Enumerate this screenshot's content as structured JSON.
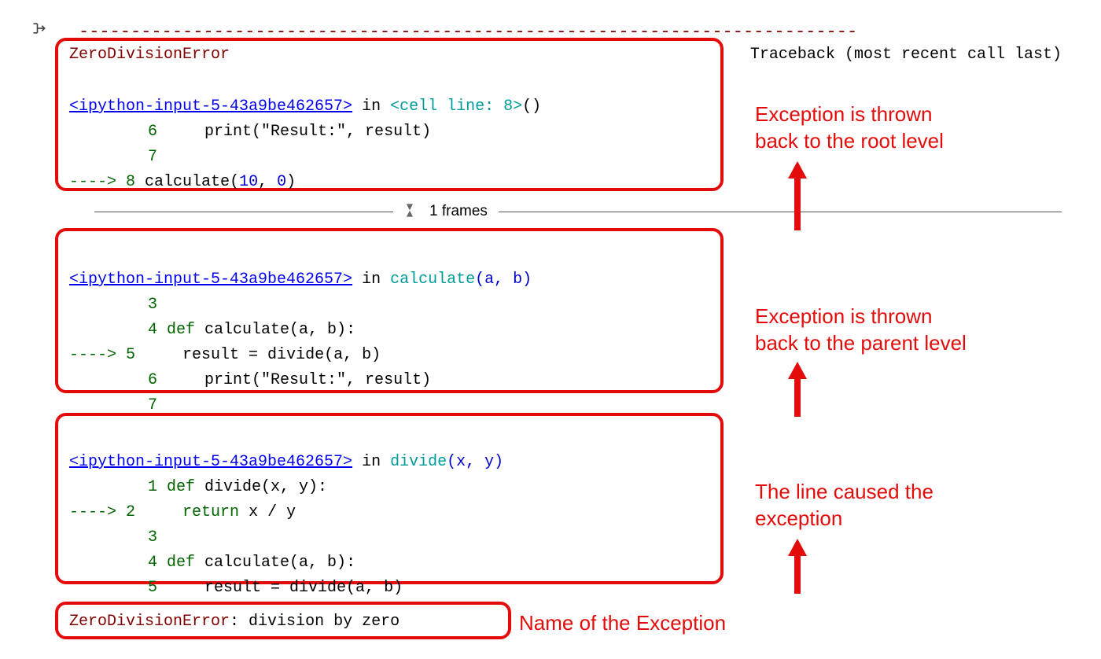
{
  "dash_line": "---------------------------------------------------------------------------",
  "header": {
    "error_name": "ZeroDivisionError",
    "traceback_label": "Traceback (most recent call last)"
  },
  "frame1": {
    "link": "<ipython-input-5-43a9be462657>",
    "in_word": " in ",
    "scope": "<cell line: 8>",
    "paren": "()",
    "l6_num": "6",
    "l6_code": "     print(\"Result:\", result)",
    "l7_num": "7",
    "l7_code": "",
    "arrow": "----> ",
    "l8_num": "8",
    "l8_pre": " calculate",
    "l8_p1": "(",
    "l8_a1": "10",
    "l8_c": ", ",
    "l8_a2": "0",
    "l8_p2": ")"
  },
  "frames_label": "1 frames",
  "frame2": {
    "link": "<ipython-input-5-43a9be462657>",
    "in_word": " in ",
    "scope": "calculate",
    "args": "(a, b)",
    "l3_num": "3",
    "l4_num": "4",
    "l4_kw": " def",
    "l4_rest": " calculate(a, b):",
    "arrow": "----> ",
    "l5_num": "5",
    "l5_code": "     result = divide(a, b)",
    "l6_num": "6",
    "l6_code": "     print(\"Result:\", result)",
    "l7_num": "7"
  },
  "frame3": {
    "link": "<ipython-input-5-43a9be462657>",
    "in_word": " in ",
    "scope": "divide",
    "args": "(x, y)",
    "l1_num": "1",
    "l1_kw": " def",
    "l1_rest": " divide(x, y):",
    "arrow": "----> ",
    "l2_num": "2",
    "l2_kw": "     return",
    "l2_rest": " x / y",
    "l3_num": "3",
    "l4_num": "4",
    "l4_kw": " def",
    "l4_rest": " calculate(a, b):",
    "l5_num": "5",
    "l5_code": "     result = divide(a, b)"
  },
  "summary": {
    "name": "ZeroDivisionError",
    "msg": ": division by zero"
  },
  "annotations": {
    "a1": "Exception is thrown\nback to the root level",
    "a2": "Exception is thrown\nback to the parent level",
    "a3": "The line caused the\nexception",
    "a4": "Name of the Exception"
  }
}
